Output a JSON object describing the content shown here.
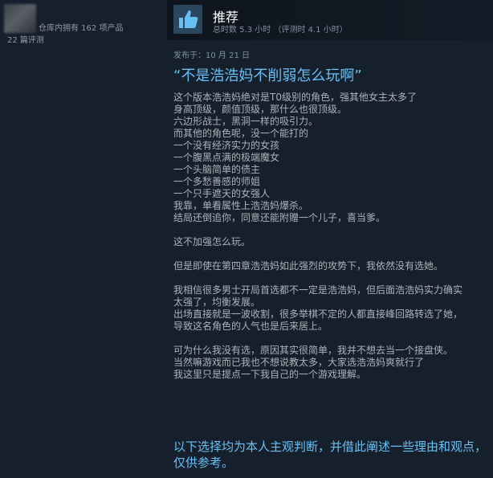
{
  "author": {
    "owned_line": "仓库内拥有 162 项产品",
    "reviews_line": "22 篇评测"
  },
  "review": {
    "icon": "thumbs-up-icon",
    "recommendation": "推荐",
    "hours": "总时数 5.3 小时 （评测时 4.1 小时）",
    "posted": "发布于：10 月 21 日",
    "quote": "“不是浩浩妈不削弱怎么玩啊”",
    "paragraphs": [
      [
        "这个版本浩浩妈绝对是T0级别的角色，强其他女主太多了",
        "身高顶级，颜值顶级，那什么也很顶级。",
        "六边形战士，黑洞一样的吸引力。",
        "而其他的角色呢，没一个能打的",
        "一个没有经济实力的女孩",
        "一个腹黑点满的极端魔女",
        "一个头脑简单的债主",
        "一个多愁善感的师姐",
        "一个只手遮天的女强人",
        "我靠，单看属性上浩浩妈爆杀。",
        "结局还倒追你，同意还能附赠一个儿子，喜当爹。"
      ],
      [
        "这不加强怎么玩。"
      ],
      [
        "但是即使在第四章浩浩妈如此强烈的攻势下，我依然没有选她。"
      ],
      [
        "我相信很多男士开局首选都不一定是浩浩妈，但后面浩浩妈实力确实",
        "太强了，均衡发展。",
        "出场直接就是一波收割，很多举棋不定的人都直接峰回路转选了她，",
        "导致这名角色的人气也是后来居上。"
      ],
      [
        "可为什么我没有选，原因其实很简单，我并不想去当一个接盘侠。",
        "当然嘛游戏而已我也不想说教太多，大家选浩浩妈爽就行了",
        "我这里只是提点一下我自己的一个游戏理解。"
      ]
    ],
    "highlight": "以下选择均为本人主观判断，并借此阐述一些理由和观点，仅供参考。"
  },
  "colors": {
    "background": "#1b2838",
    "accent": "#66c0f4",
    "text": "#acb2b8"
  }
}
